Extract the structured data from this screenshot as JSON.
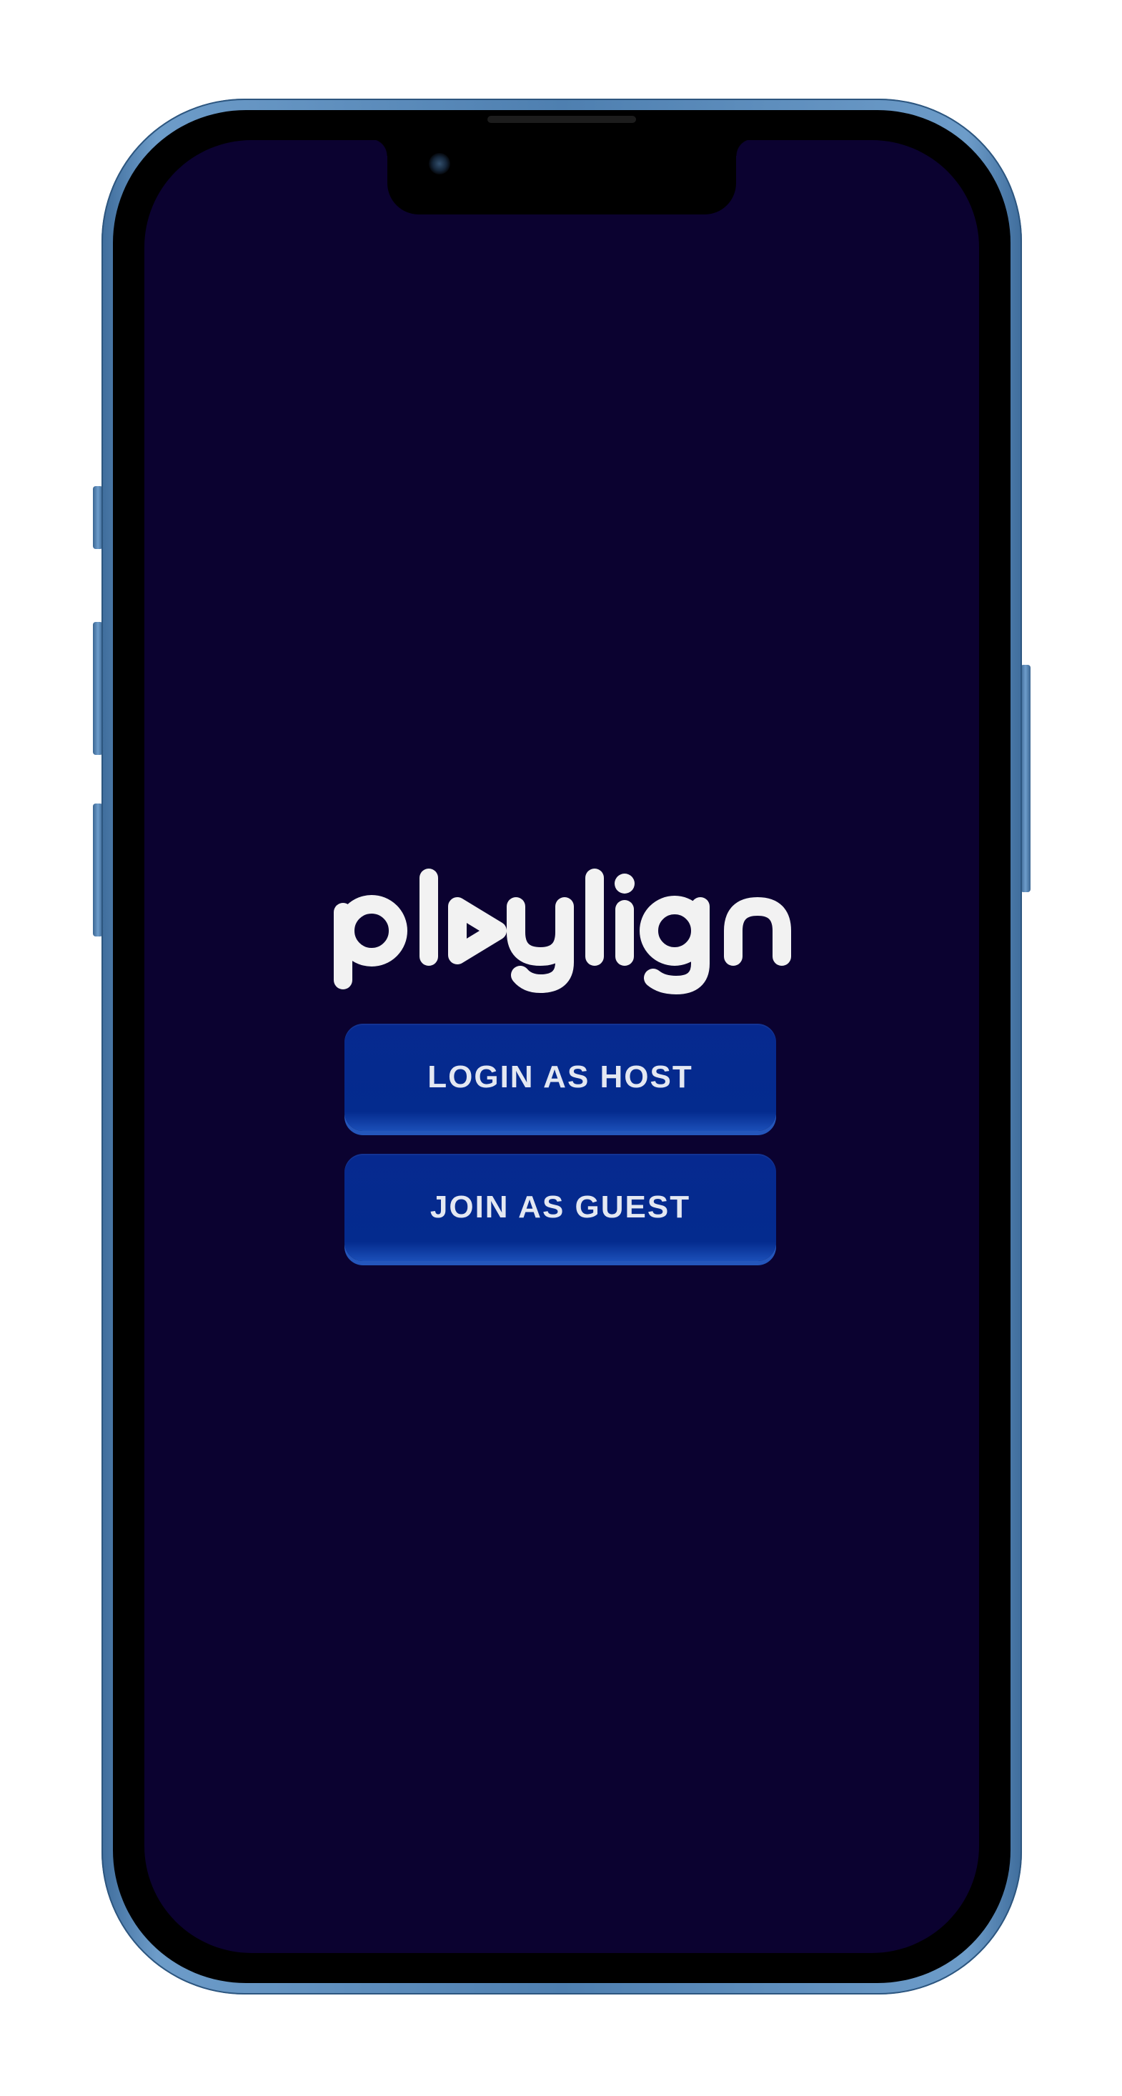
{
  "app": {
    "logo_text": "playlign"
  },
  "actions": {
    "login_host_label": "LOGIN AS HOST",
    "join_guest_label": "JOIN AS GUEST"
  },
  "colors": {
    "screen_background": "#0b0230",
    "button_background": "#042b8e",
    "button_text": "#e4e8f2",
    "logo": "#f2f2f2",
    "device_frame": "#4e7fb0"
  }
}
